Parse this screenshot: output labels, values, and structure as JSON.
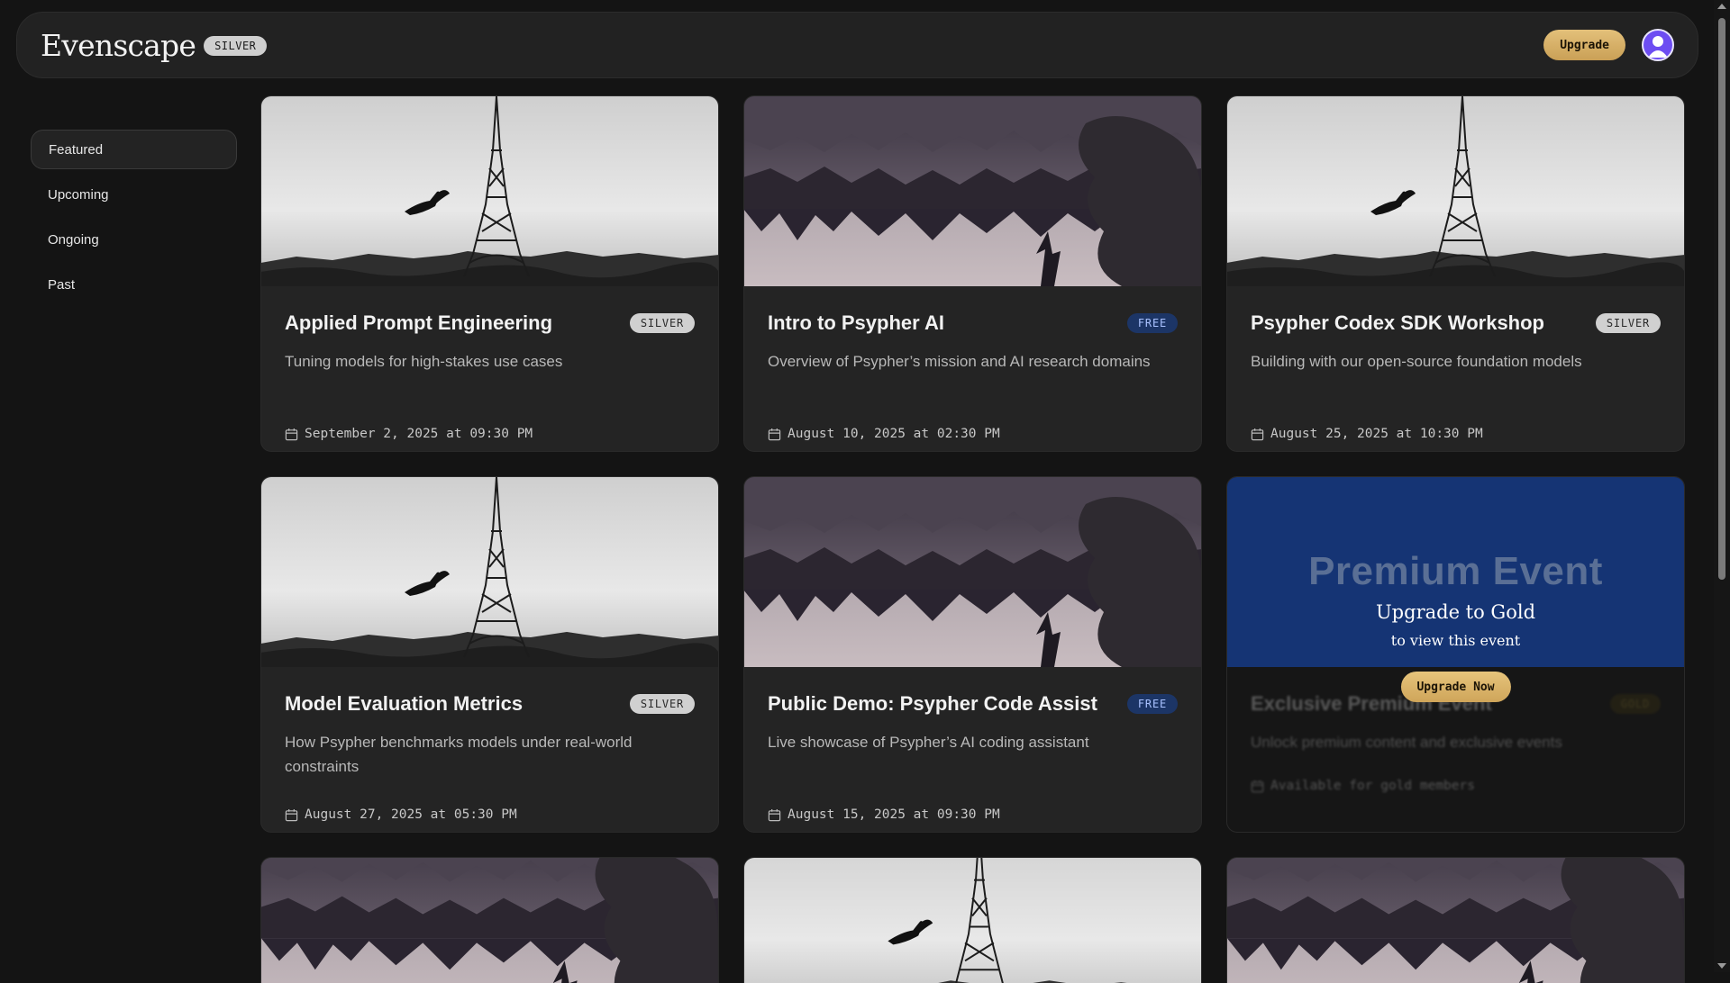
{
  "header": {
    "logo": "Evenscape",
    "tier_badge": "SILVER",
    "upgrade_label": "Upgrade",
    "avatar_icon": "user-avatar-icon"
  },
  "sidebar": {
    "items": [
      {
        "label": "Featured",
        "active": true
      },
      {
        "label": "Upcoming",
        "active": false
      },
      {
        "label": "Ongoing",
        "active": false
      },
      {
        "label": "Past",
        "active": false
      }
    ]
  },
  "events": [
    {
      "title": "Applied Prompt Engineering",
      "badge": "SILVER",
      "description": "Tuning models for high-stakes use cases",
      "date": "September 2, 2025 at 09:30 PM",
      "image": "eiffel-tower"
    },
    {
      "title": "Intro to Psypher AI",
      "badge": "FREE",
      "description": "Overview of Psypher’s mission and AI research domains",
      "date": "August 10, 2025 at 02:30 PM",
      "image": "forest-lake"
    },
    {
      "title": "Psypher Codex SDK Workshop",
      "badge": "SILVER",
      "description": "Building with our open-source foundation models",
      "date": "August 25, 2025 at 10:30 PM",
      "image": "eiffel-tower"
    },
    {
      "title": "Model Evaluation Metrics",
      "badge": "SILVER",
      "description": "How Psypher benchmarks models under real-world constraints",
      "date": "August 27, 2025 at 05:30 PM",
      "image": "eiffel-tower"
    },
    {
      "title": "Public Demo: Psypher Code Assist",
      "badge": "FREE",
      "description": "Live showcase of Psypher’s AI coding assistant",
      "date": "August 15, 2025 at 09:30 PM",
      "image": "forest-lake"
    }
  ],
  "premium_card": {
    "heading": "Premium Event",
    "subheading": "Upgrade to Gold",
    "subtext": "to view this event",
    "button_label": "Upgrade Now",
    "title": "Exclusive Premium Event",
    "badge": "GOLD",
    "description": "Unlock premium content and exclusive events",
    "date_text": "Available for gold members"
  },
  "partial_row_images": [
    "forest-lake",
    "eiffel-tower",
    "forest-lake"
  ],
  "colors": {
    "background": "#141414",
    "card": "#242424",
    "gold_accent": "#d9b56a",
    "free_badge": "#1c3566",
    "premium_blue": "#153474"
  }
}
